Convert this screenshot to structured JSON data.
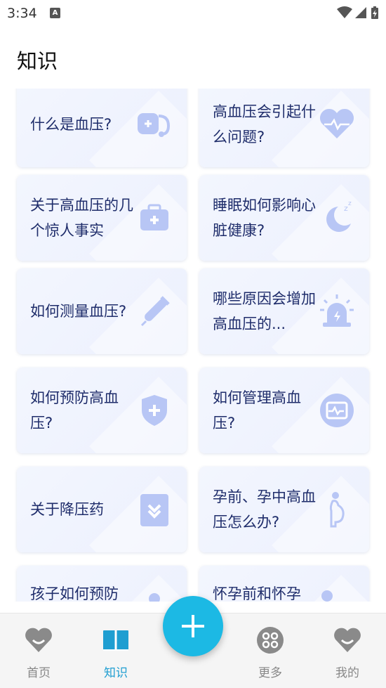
{
  "status": {
    "time": "3:34",
    "notif_icon": "A"
  },
  "header": {
    "title": "知识"
  },
  "cards": [
    {
      "title": "什么是血压?",
      "icon": "stethoscope-icon"
    },
    {
      "title": "高血压会引起什么问题?",
      "icon": "heart-pulse-icon"
    },
    {
      "title": "关于高血压的几个惊人事实",
      "icon": "medical-kit-icon"
    },
    {
      "title": "睡眠如何影响心脏健康?",
      "icon": "moon-sleep-icon"
    },
    {
      "title": "如何测量血压?",
      "icon": "dropper-icon"
    },
    {
      "title": "哪些原因会增加高血压的...",
      "icon": "alarm-light-icon"
    },
    {
      "title": "如何预防高血压?",
      "icon": "shield-plus-icon"
    },
    {
      "title": "如何管理高血压?",
      "icon": "heart-monitor-icon"
    },
    {
      "title": "关于降压药",
      "icon": "pill-box-icon"
    },
    {
      "title": "孕前、孕中高血压怎么办?",
      "icon": "pregnant-woman-icon"
    },
    {
      "title": "孩子如何预防",
      "icon": "child-icon"
    },
    {
      "title": "怀孕前和怀孕",
      "icon": "person-icon"
    }
  ],
  "nav": [
    {
      "label": "首页",
      "icon": "heart-smile-icon"
    },
    {
      "label": "知识",
      "icon": "book-icon"
    },
    {
      "label": "更多",
      "icon": "grid-icon"
    },
    {
      "label": "我的",
      "icon": "heart-smile-icon"
    }
  ],
  "colors": {
    "accent": "#1cb9e4",
    "card_text": "#1f2d6b",
    "icon_light": "#b8c6f5"
  }
}
